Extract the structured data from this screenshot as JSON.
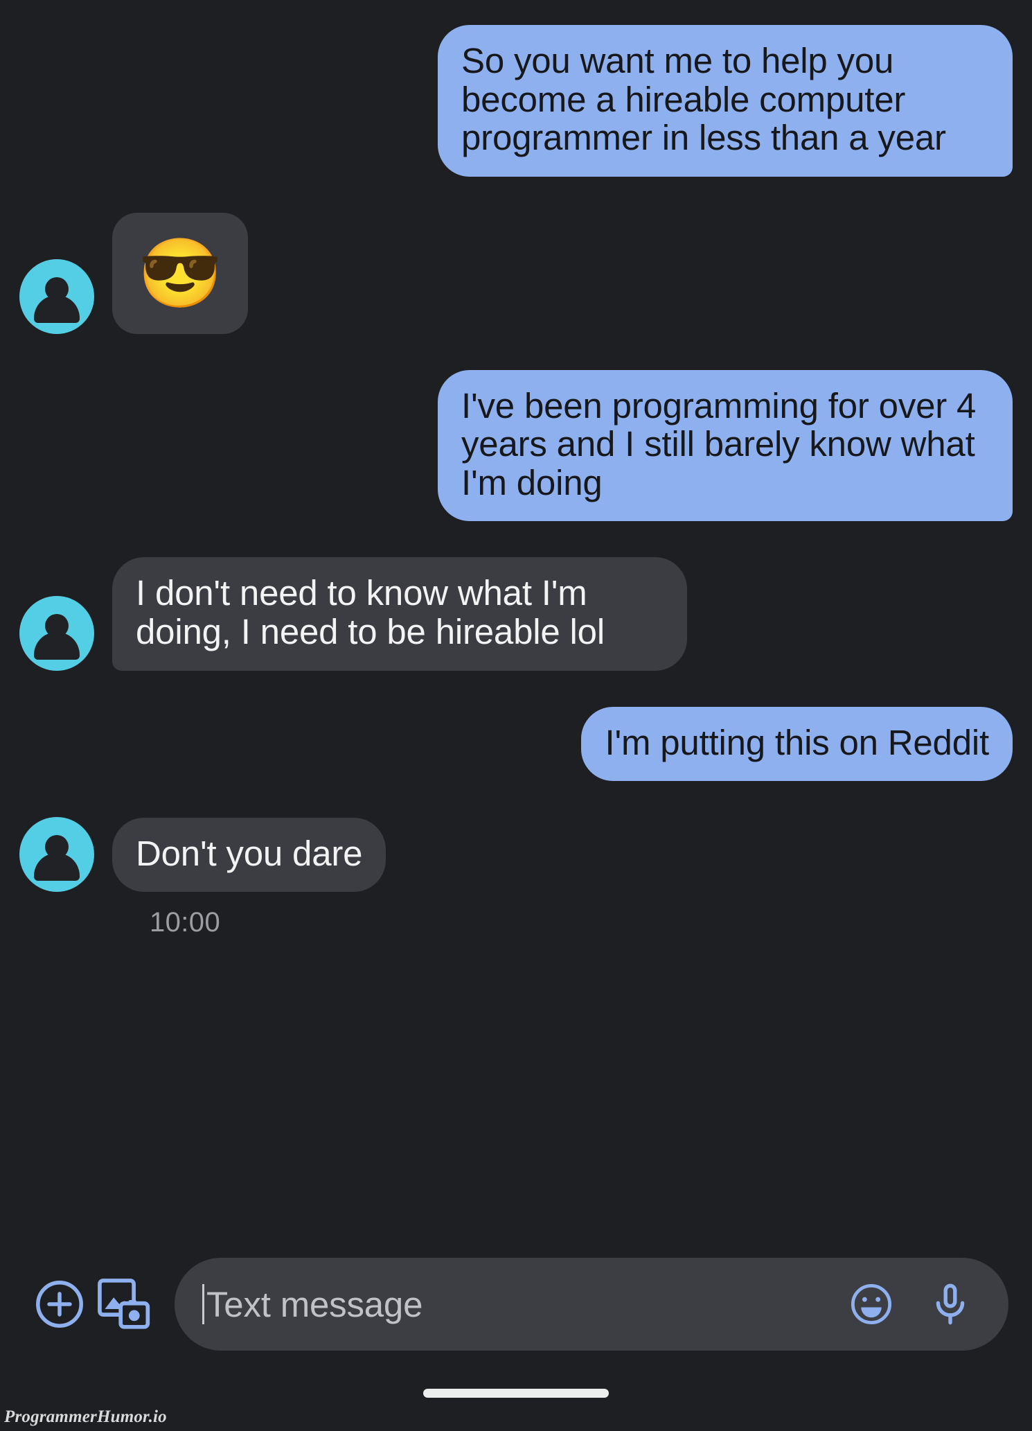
{
  "app": {
    "background_color": "#1e1f22",
    "outgoing_bubble_color": "#8eb0ee",
    "outgoing_text_color": "#17181b",
    "incoming_bubble_color": "#3b3d42",
    "incoming_text_color": "#f3f3f4",
    "avatar_color": "#54cee4",
    "accent_icon_color": "#8eb0ee"
  },
  "conversation": {
    "messages": [
      {
        "id": "msg-1",
        "direction": "outgoing",
        "type": "text",
        "text": "So you want me to help you become a hireable computer programmer in less than a year"
      },
      {
        "id": "msg-2",
        "direction": "incoming",
        "type": "emoji",
        "text": "😎",
        "emoji_name": "smiling-face-with-sunglasses"
      },
      {
        "id": "msg-3",
        "direction": "outgoing",
        "type": "text",
        "text": "I've been programming for over 4 years and I still barely know what I'm doing"
      },
      {
        "id": "msg-4",
        "direction": "incoming",
        "type": "text",
        "text": "I don't need to know what I'm doing, I need to be hireable lol"
      },
      {
        "id": "msg-5",
        "direction": "outgoing",
        "type": "text",
        "text": "I'm putting this on Reddit"
      },
      {
        "id": "msg-6",
        "direction": "incoming",
        "type": "text",
        "text": "Don't you dare"
      }
    ],
    "timestamp": "10:00"
  },
  "composer": {
    "attach_icon": "plus-circle-icon",
    "gallery_icon": "image-camera-icon",
    "placeholder": "Text message",
    "value": "",
    "emoji_icon": "emoji-smiley-icon",
    "mic_icon": "microphone-icon"
  },
  "watermark": {
    "text": "ProgrammerHumor.io"
  }
}
